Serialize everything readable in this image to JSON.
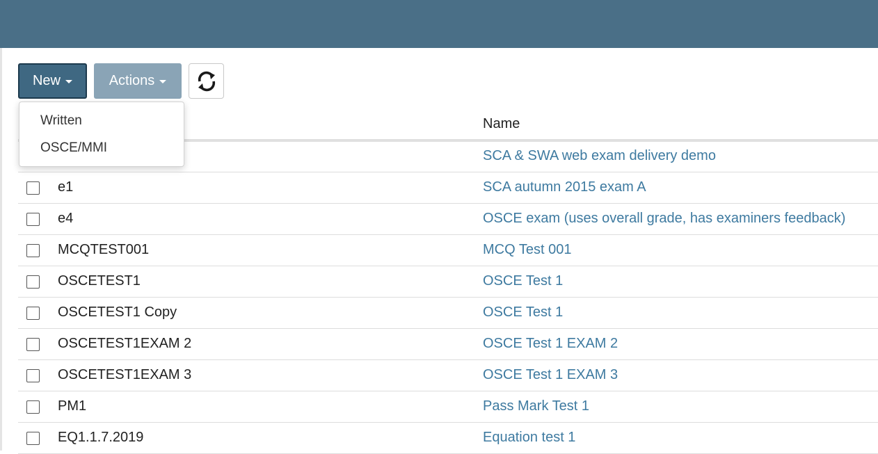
{
  "toolbar": {
    "new_label": "New",
    "actions_label": "Actions",
    "refresh_icon": "refresh-icon"
  },
  "dropdown": {
    "items": [
      {
        "label": "Written"
      },
      {
        "label": "OSCE/MMI"
      }
    ]
  },
  "table": {
    "columns": {
      "code": "",
      "name": "Name"
    },
    "rows": [
      {
        "code": "",
        "name": "SCA & SWA web exam delivery demo"
      },
      {
        "code": "e1",
        "name": "SCA autumn 2015 exam A"
      },
      {
        "code": "e4",
        "name": "OSCE exam (uses overall grade, has examiners feedback)"
      },
      {
        "code": "MCQTEST001",
        "name": "MCQ Test 001"
      },
      {
        "code": "OSCETEST1",
        "name": "OSCE Test 1"
      },
      {
        "code": "OSCETEST1 Copy",
        "name": "OSCE Test 1"
      },
      {
        "code": "OSCETEST1EXAM 2",
        "name": "OSCE Test 1 EXAM 2"
      },
      {
        "code": "OSCETEST1EXAM 3",
        "name": "OSCE Test 1 EXAM 3"
      },
      {
        "code": "PM1",
        "name": "Pass Mark Test 1"
      },
      {
        "code": "EQ1.1.7.2019",
        "name": "Equation test 1"
      }
    ]
  },
  "colors": {
    "topbar": "#4a6f87",
    "primary_button": "#3f6882",
    "disabled_button": "#8aa4b6",
    "link": "#3e7aa0"
  }
}
